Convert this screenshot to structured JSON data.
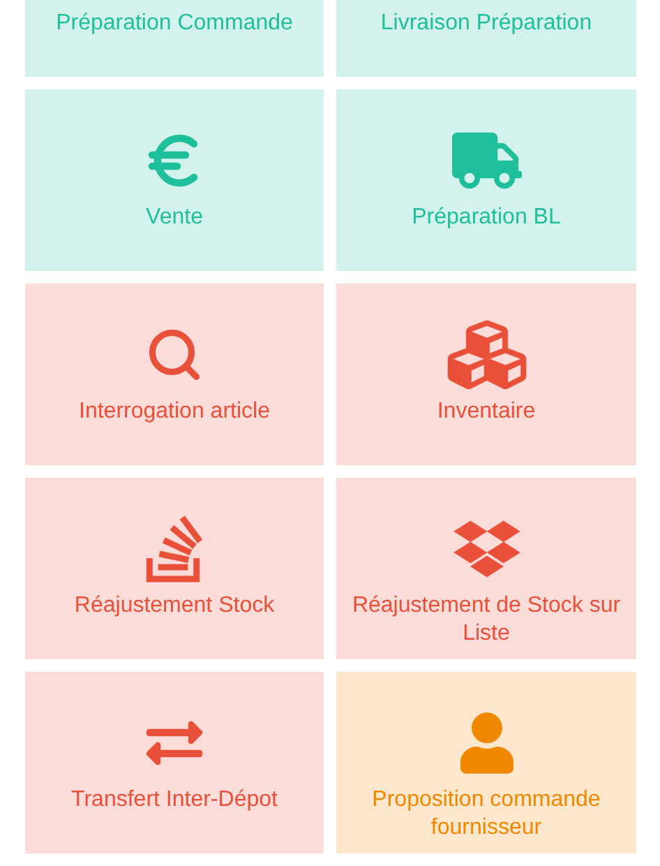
{
  "tiles": [
    {
      "label": "Préparation Commande",
      "color": "#1fbf9c"
    },
    {
      "label": "Livraison Préparation",
      "color": "#1fbf9c"
    },
    {
      "label": "Vente",
      "kind": "euro",
      "color": "#1fbf9c"
    },
    {
      "label": "Préparation BL",
      "kind": "truck",
      "color": "#1fbf9c"
    },
    {
      "label": "Interrogation article",
      "kind": "search",
      "color": "#e9503a"
    },
    {
      "label": "Inventaire",
      "kind": "cubes",
      "color": "#e9503a"
    },
    {
      "label": "Réajustement Stock",
      "kind": "stack",
      "color": "#e9503a"
    },
    {
      "label": "Réajustement de Stock sur Liste",
      "kind": "dropbox",
      "color": "#e9503a"
    },
    {
      "label": "Transfert Inter-Dépot",
      "kind": "swap",
      "color": "#e9503a"
    },
    {
      "label": "Proposition commande fournisseur",
      "kind": "user",
      "color": "#ef8800"
    }
  ]
}
